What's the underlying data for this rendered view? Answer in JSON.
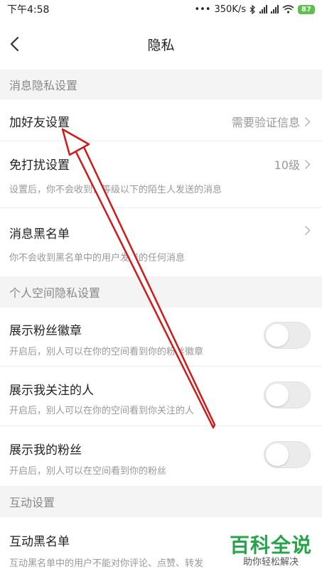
{
  "status_bar": {
    "time": "下午4:58",
    "network_speed": "350K/s",
    "battery_level": "87",
    "icons": [
      "bluetooth-icon",
      "signal-icon",
      "wifi-icon",
      "battery-icon"
    ]
  },
  "nav": {
    "title": "隐私",
    "back_icon": "chevron-left-icon"
  },
  "sections": {
    "message_privacy": {
      "header": "消息隐私设置",
      "add_friend": {
        "title": "加好友设置",
        "value": "需要验证信息"
      },
      "do_not_disturb": {
        "title": "免打扰设置",
        "value": "10级",
        "description": "设置后，你不会收到该等级以下的陌生人发送的消息"
      },
      "message_blacklist": {
        "title": "消息黑名单",
        "description": "你不会收到黑名单中的用户发送的任何消息"
      }
    },
    "personal_space": {
      "header": "个人空间隐私设置",
      "fan_badge": {
        "title": "展示粉丝徽章",
        "description": "开启后，别人可以在你的空间看到你的粉丝徽章",
        "enabled": false
      },
      "following": {
        "title": "展示我关注的人",
        "description": "开启后，别人可以在你的空间看到你关注的人",
        "enabled": false
      },
      "fans": {
        "title": "展示我的粉丝",
        "description": "开启后，别人可以在空间看到你的粉丝",
        "enabled": false
      }
    },
    "interaction": {
      "header": "互动设置",
      "interaction_blacklist": {
        "title": "互动黑名单",
        "description": "互动黑名单中的用户不能对你评论、点赞、转发"
      }
    }
  },
  "watermark": {
    "main": "百科全说",
    "sub": "助你轻松解决"
  },
  "colors": {
    "accent_red": "#d01a1a",
    "watermark_green": "#25a449",
    "section_bg": "#f4f4f4"
  }
}
